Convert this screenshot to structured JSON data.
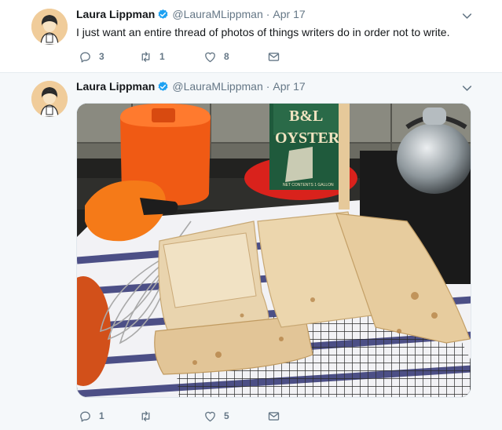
{
  "tweets": [
    {
      "author_name": "Laura Lippman",
      "handle": "@LauraMLippman",
      "separator": "·",
      "date": "Apr 17",
      "text": "I just want an entire thread of photos of things writers do in order not to write.",
      "reply_count": "3",
      "retweet_count": "1",
      "like_count": "8"
    },
    {
      "author_name": "Laura Lippman",
      "handle": "@LauraMLippman",
      "separator": "·",
      "date": "Apr 17",
      "photo_text": {
        "tin_top": "B&L",
        "tin_brand": "OYSTER",
        "tin_bottom": "NET CONTENTS 1 GALLON"
      },
      "reply_count": "1",
      "retweet_count": "",
      "like_count": "5"
    }
  ],
  "icons": {
    "verified": "verified-badge-icon",
    "caret": "chevron-down-icon",
    "reply": "reply-icon",
    "retweet": "retweet-icon",
    "like": "heart-icon",
    "dm": "envelope-icon"
  },
  "colors": {
    "verified_blue": "#1da1f2",
    "thread_line": "#9bd1f9",
    "meta_gray": "#657786",
    "background_alt": "#f5f8fa"
  }
}
